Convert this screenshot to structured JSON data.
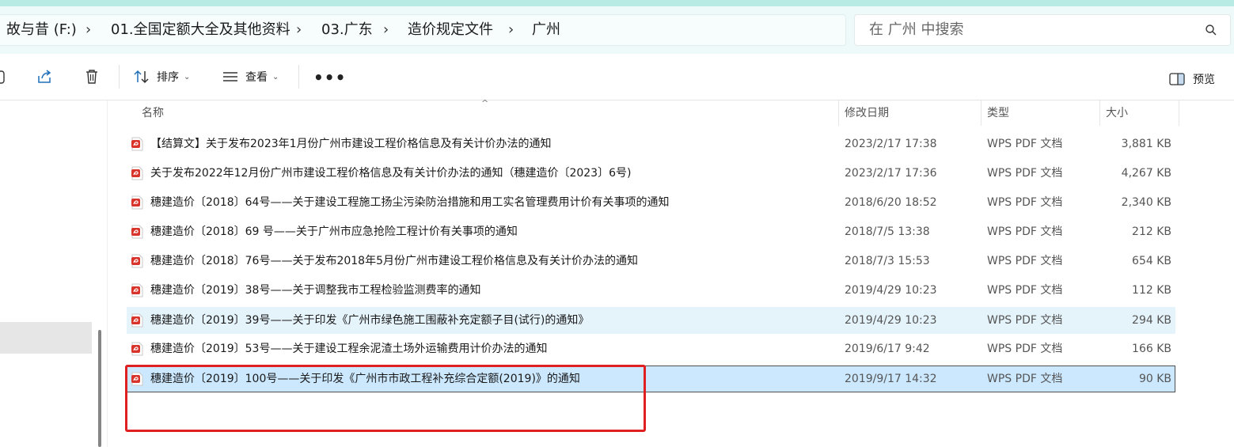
{
  "breadcrumb": {
    "items": [
      "故与昔 (F:)",
      "01.全国定额大全及其他资料",
      "03.广东",
      "造价规定文件",
      "广州"
    ],
    "separator": "›"
  },
  "search": {
    "placeholder": "在 广州 中搜索"
  },
  "toolbar": {
    "sort_label": "排序",
    "view_label": "查看",
    "more_label": "•••",
    "preview_label": "预览"
  },
  "columns": {
    "name": "名称",
    "date": "修改日期",
    "type": "类型",
    "size": "大小"
  },
  "files": [
    {
      "name": "【结算文】关于发布2023年1月份广州市建设工程价格信息及有关计价办法的通知",
      "date": "2023/2/17 17:38",
      "type": "WPS PDF 文档",
      "size": "3,881 KB"
    },
    {
      "name": "关于发布2022年12月份广州市建设工程价格信息及有关计价办法的通知（穗建造价〔2023〕6号)",
      "date": "2023/2/17 17:36",
      "type": "WPS PDF 文档",
      "size": "4,267 KB"
    },
    {
      "name": "穗建造价〔2018〕64号——关于建设工程施工扬尘污染防治措施和用工实名管理费用计价有关事项的通知",
      "date": "2018/6/20 18:52",
      "type": "WPS PDF 文档",
      "size": "2,340 KB"
    },
    {
      "name": "穗建造价〔2018〕69 号——关于广州市应急抢险工程计价有关事项的通知",
      "date": "2018/7/5 13:38",
      "type": "WPS PDF 文档",
      "size": "212 KB"
    },
    {
      "name": "穗建造价〔2018〕76号——关于发布2018年5月份广州市建设工程价格信息及有关计价办法的通知",
      "date": "2018/7/3 15:53",
      "type": "WPS PDF 文档",
      "size": "654 KB"
    },
    {
      "name": "穗建造价〔2019〕38号——关于调整我市工程检验监测费率的通知",
      "date": "2019/4/29 10:23",
      "type": "WPS PDF 文档",
      "size": "112 KB"
    },
    {
      "name": "穗建造价〔2019〕39号——关于印发《广州市绿色施工围蔽补充定额子目(试行)的通知》",
      "date": "2019/4/29 10:23",
      "type": "WPS PDF 文档",
      "size": "294 KB"
    },
    {
      "name": "穗建造价〔2019〕53号——关于建设工程余泥渣土场外运输费用计价办法的通知",
      "date": "2019/6/17 9:42",
      "type": "WPS PDF 文档",
      "size": "166 KB"
    },
    {
      "name": "穗建造价〔2019〕100号——关于印发《广州市市政工程补充综合定额(2019)》的通知",
      "date": "2019/9/17 14:32",
      "type": "WPS PDF 文档",
      "size": "90 KB"
    }
  ],
  "colors": {
    "selected_row": "#cce8ff",
    "hover_row": "#e5f3fb",
    "highlight_box": "#e02020",
    "pdf_icon": "#d9342b"
  }
}
